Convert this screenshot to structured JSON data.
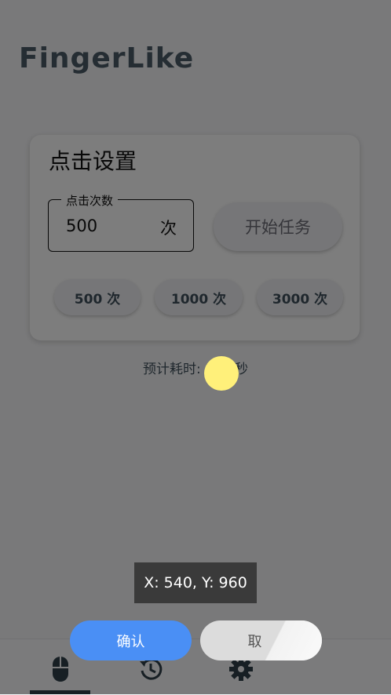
{
  "app": {
    "title": "FingerLike"
  },
  "click_settings": {
    "title": "点击设置",
    "count_field": {
      "label": "点击次数",
      "value": "500",
      "suffix": "次"
    },
    "start_button": "开始任务",
    "presets": [
      "500 次",
      "1000 次",
      "3000 次"
    ]
  },
  "estimate_text": "预计耗时: 1  28秒",
  "bottom_nav": {
    "items": [
      {
        "icon": "mouse-icon",
        "selected": true
      },
      {
        "icon": "history-icon",
        "selected": false
      },
      {
        "icon": "settings-gear-icon",
        "selected": false
      }
    ]
  },
  "overlay": {
    "coordinate_text": "X: 540, Y: 960",
    "confirm_label": "确认",
    "cancel_label": "取"
  },
  "colors": {
    "overlay": "#000000",
    "touch_dot": "#fff07a",
    "confirm_button": "#4a8ff5",
    "cancel_button": "#dcdcdc",
    "title_text": "#4a5a66"
  }
}
